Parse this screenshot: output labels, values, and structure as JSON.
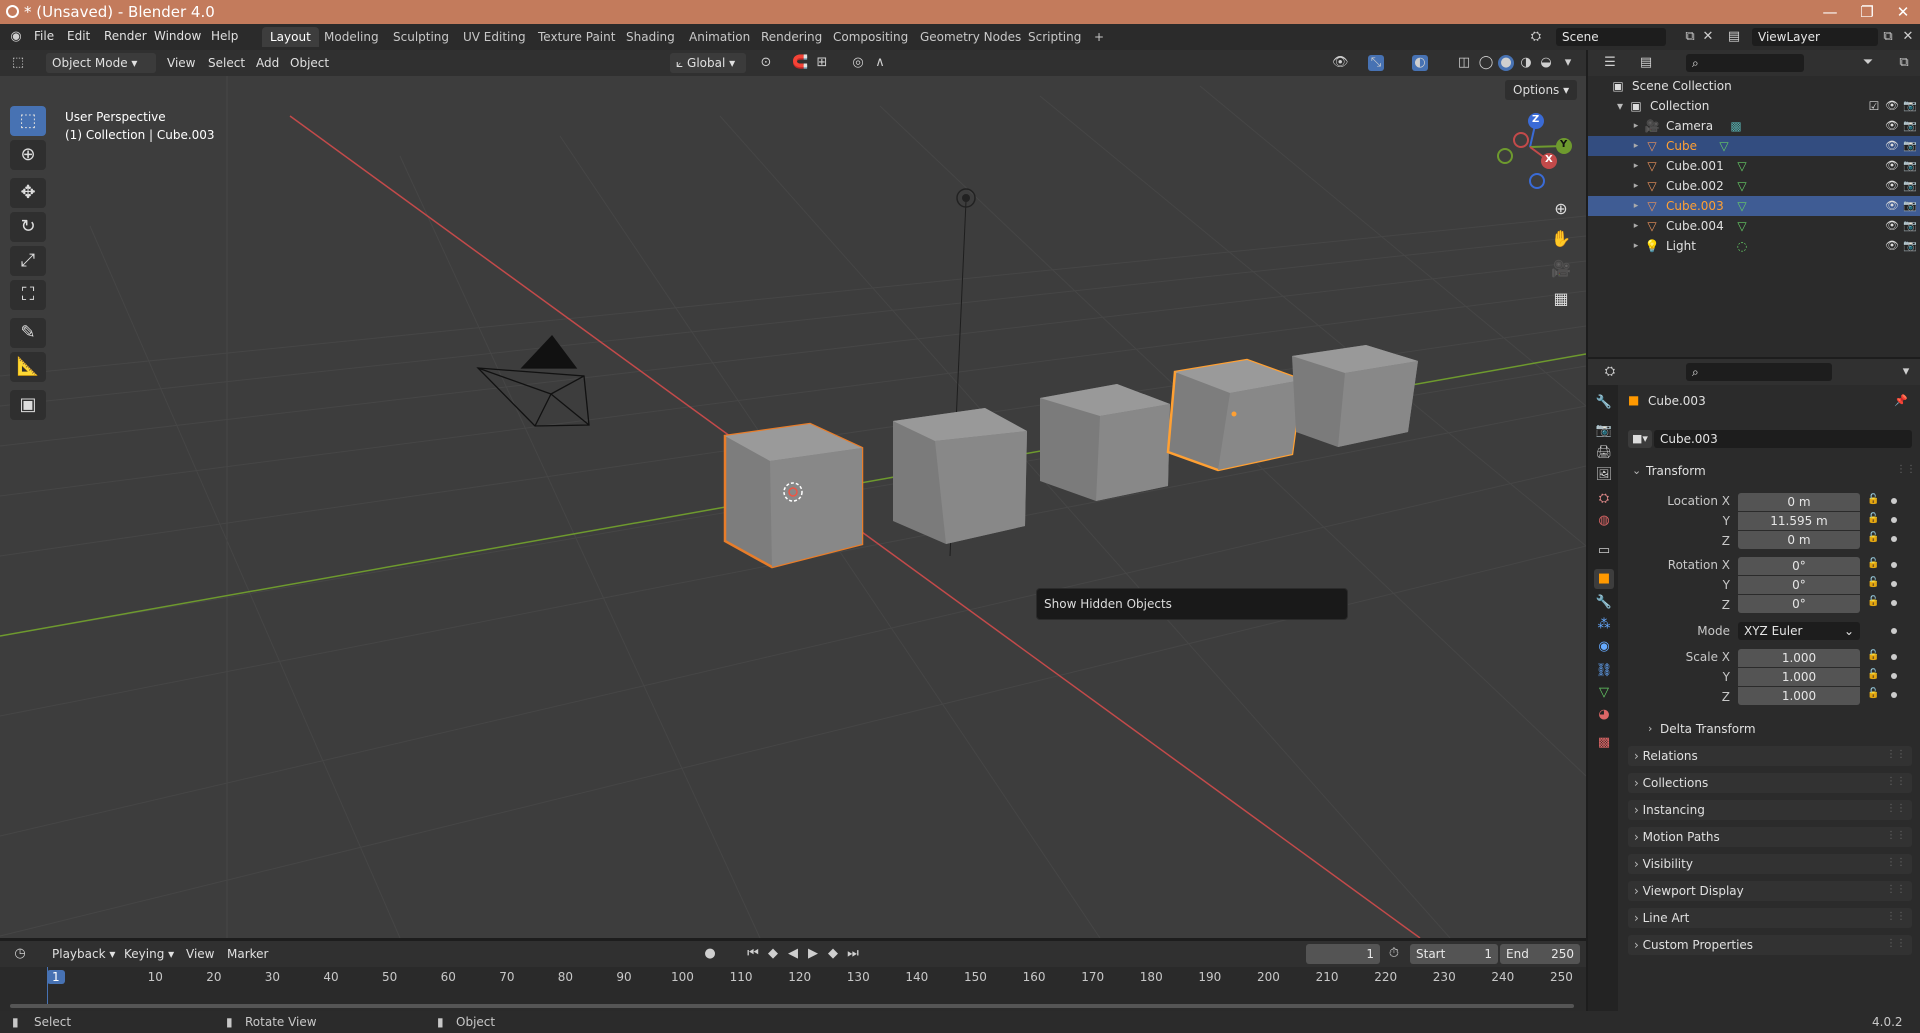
{
  "window": {
    "title": "* (Unsaved) - Blender 4.0",
    "min": "—",
    "max": "❐",
    "close": "✕"
  },
  "menu": [
    "File",
    "Edit",
    "Render",
    "Window",
    "Help"
  ],
  "workspaces": [
    "Layout",
    "Modeling",
    "Sculpting",
    "UV Editing",
    "Texture Paint",
    "Shading",
    "Animation",
    "Rendering",
    "Compositing",
    "Geometry Nodes",
    "Scripting",
    "+"
  ],
  "scene": "Scene",
  "view_layer": "ViewLayer",
  "viewport_header": {
    "mode": "Object Mode",
    "menus": [
      "View",
      "Select",
      "Add",
      "Object"
    ],
    "orientation": "Global",
    "options": "Options"
  },
  "viewport": {
    "info_line1": "User Perspective",
    "info_line2": "(1) Collection | Cube.003",
    "tooltip": "Show Hidden Objects",
    "gizmo": {
      "z": "Z",
      "y": "Y",
      "x": "X"
    }
  },
  "timeline_header": {
    "menus": [
      "Playback",
      "Keying",
      "View",
      "Marker"
    ],
    "current_frame": "1",
    "start_label": "Start",
    "start": "1",
    "end_label": "End",
    "end": "250"
  },
  "timeline_ticks": [
    "1",
    "10",
    "20",
    "30",
    "40",
    "50",
    "60",
    "70",
    "80",
    "90",
    "100",
    "110",
    "120",
    "130",
    "140",
    "150",
    "160",
    "170",
    "180",
    "190",
    "200",
    "210",
    "220",
    "230",
    "240",
    "250"
  ],
  "statusbar": {
    "select": "Select",
    "rotate": "Rotate View",
    "object": "Object",
    "version": "4.0.2"
  },
  "outliner": {
    "scene_collection": "Scene Collection",
    "collection": "Collection",
    "items": [
      {
        "name": "Camera",
        "type": "camera"
      },
      {
        "name": "Cube",
        "type": "mesh"
      },
      {
        "name": "Cube.001",
        "type": "mesh"
      },
      {
        "name": "Cube.002",
        "type": "mesh"
      },
      {
        "name": "Cube.003",
        "type": "mesh"
      },
      {
        "name": "Cube.004",
        "type": "mesh"
      },
      {
        "name": "Light",
        "type": "light"
      }
    ]
  },
  "properties": {
    "object_name": "Cube.003",
    "object_field": "Cube.003",
    "transform_label": "Transform",
    "location_label": "Location X",
    "location": {
      "x": "0 m",
      "y": "11.595 m",
      "z": "0 m"
    },
    "rotation_label": "Rotation X",
    "rotation": {
      "x": "0°",
      "y": "0°",
      "z": "0°"
    },
    "mode_label": "Mode",
    "mode": "XYZ Euler",
    "scale_label": "Scale X",
    "scale": {
      "x": "1.000",
      "y": "1.000",
      "z": "1.000"
    },
    "y_label": "Y",
    "z_label": "Z",
    "delta": "Delta Transform",
    "panels": [
      "Relations",
      "Collections",
      "Instancing",
      "Motion Paths",
      "Visibility",
      "Viewport Display",
      "Line Art",
      "Custom Properties"
    ]
  },
  "colors": {
    "selected_outline": "#e87d2a",
    "active_outline": "#ffa033",
    "x_axis": "#c34a4a",
    "y_axis": "#6e9a2e",
    "accent": "#4772b3"
  }
}
